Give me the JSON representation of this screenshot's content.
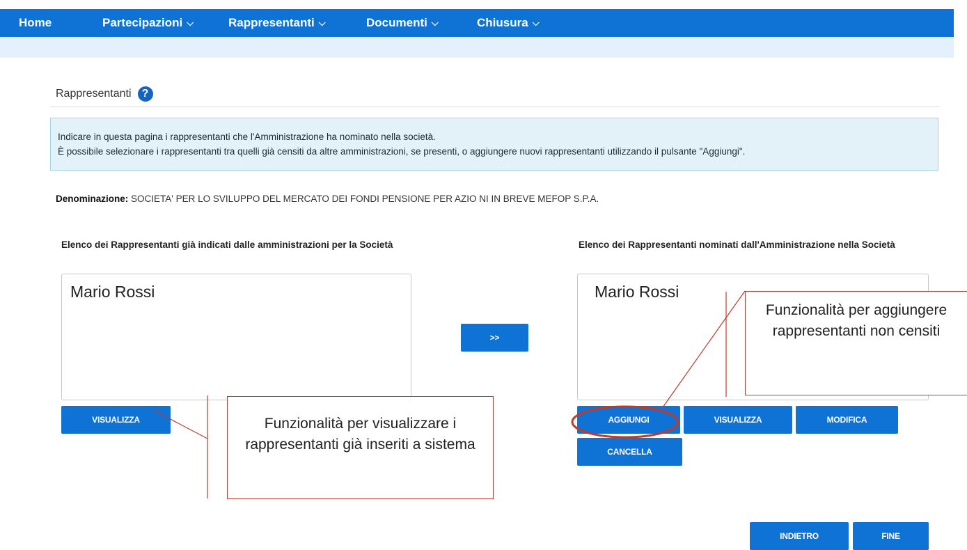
{
  "nav": {
    "home": "Home",
    "items": [
      {
        "label": "Partecipazioni",
        "icon": "chevron-down-icon"
      },
      {
        "label": "Rappresentanti",
        "icon": "chevron-down-icon"
      },
      {
        "label": "Documenti",
        "icon": "chevron-down-icon"
      },
      {
        "label": "Chiusura",
        "icon": "chevron-down-icon"
      }
    ]
  },
  "page": {
    "title": "Rappresentanti",
    "help_icon": "?"
  },
  "info": {
    "line1": "Indicare in questa pagina i rappresentanti che l'Amministrazione ha nominato nella società.",
    "line2": "È possibile selezionare i rappresentanti tra quelli già censiti da altre amministrazioni, se presenti, o aggiungere nuovi rappresentanti utilizzando il pulsante \"Aggiungi\"."
  },
  "denominazione": {
    "label": "Denominazione:",
    "value": " SOCIETA' PER LO SVILUPPO DEL MERCATO DEI FONDI PENSIONE PER AZIO NI IN BREVE MEFOP S.P.A."
  },
  "left_list": {
    "label": "Elenco dei Rappresentanti già indicati dalle amministrazioni per la Società",
    "items": [
      "Mario Rossi"
    ],
    "buttons": {
      "visualizza": "VISUALIZZA"
    }
  },
  "transfer_button": ">>",
  "right_list": {
    "label": "Elenco dei Rappresentanti nominati dall'Amministrazione nella Società",
    "items": [
      "Mario Rossi"
    ],
    "buttons": {
      "aggiungi": "AGGIUNGI",
      "visualizza": "VISUALIZZA",
      "modifica": "MODIFICA",
      "cancella": "CANCELLA"
    }
  },
  "footer": {
    "indietro": "INDIETRO",
    "fine": "FINE"
  },
  "callouts": {
    "right": "Funzionalità per aggiungere rappresentanti non censiti",
    "left": "Funzionalità per visualizzare i rappresentanti già inseriti a sistema"
  },
  "colors": {
    "nav_bg": "#0f73d6",
    "subbar_bg": "#e4f0fb",
    "button_bg": "#0f73d6",
    "info_bg": "#e3f1f8",
    "annotation": "#c0392b"
  }
}
